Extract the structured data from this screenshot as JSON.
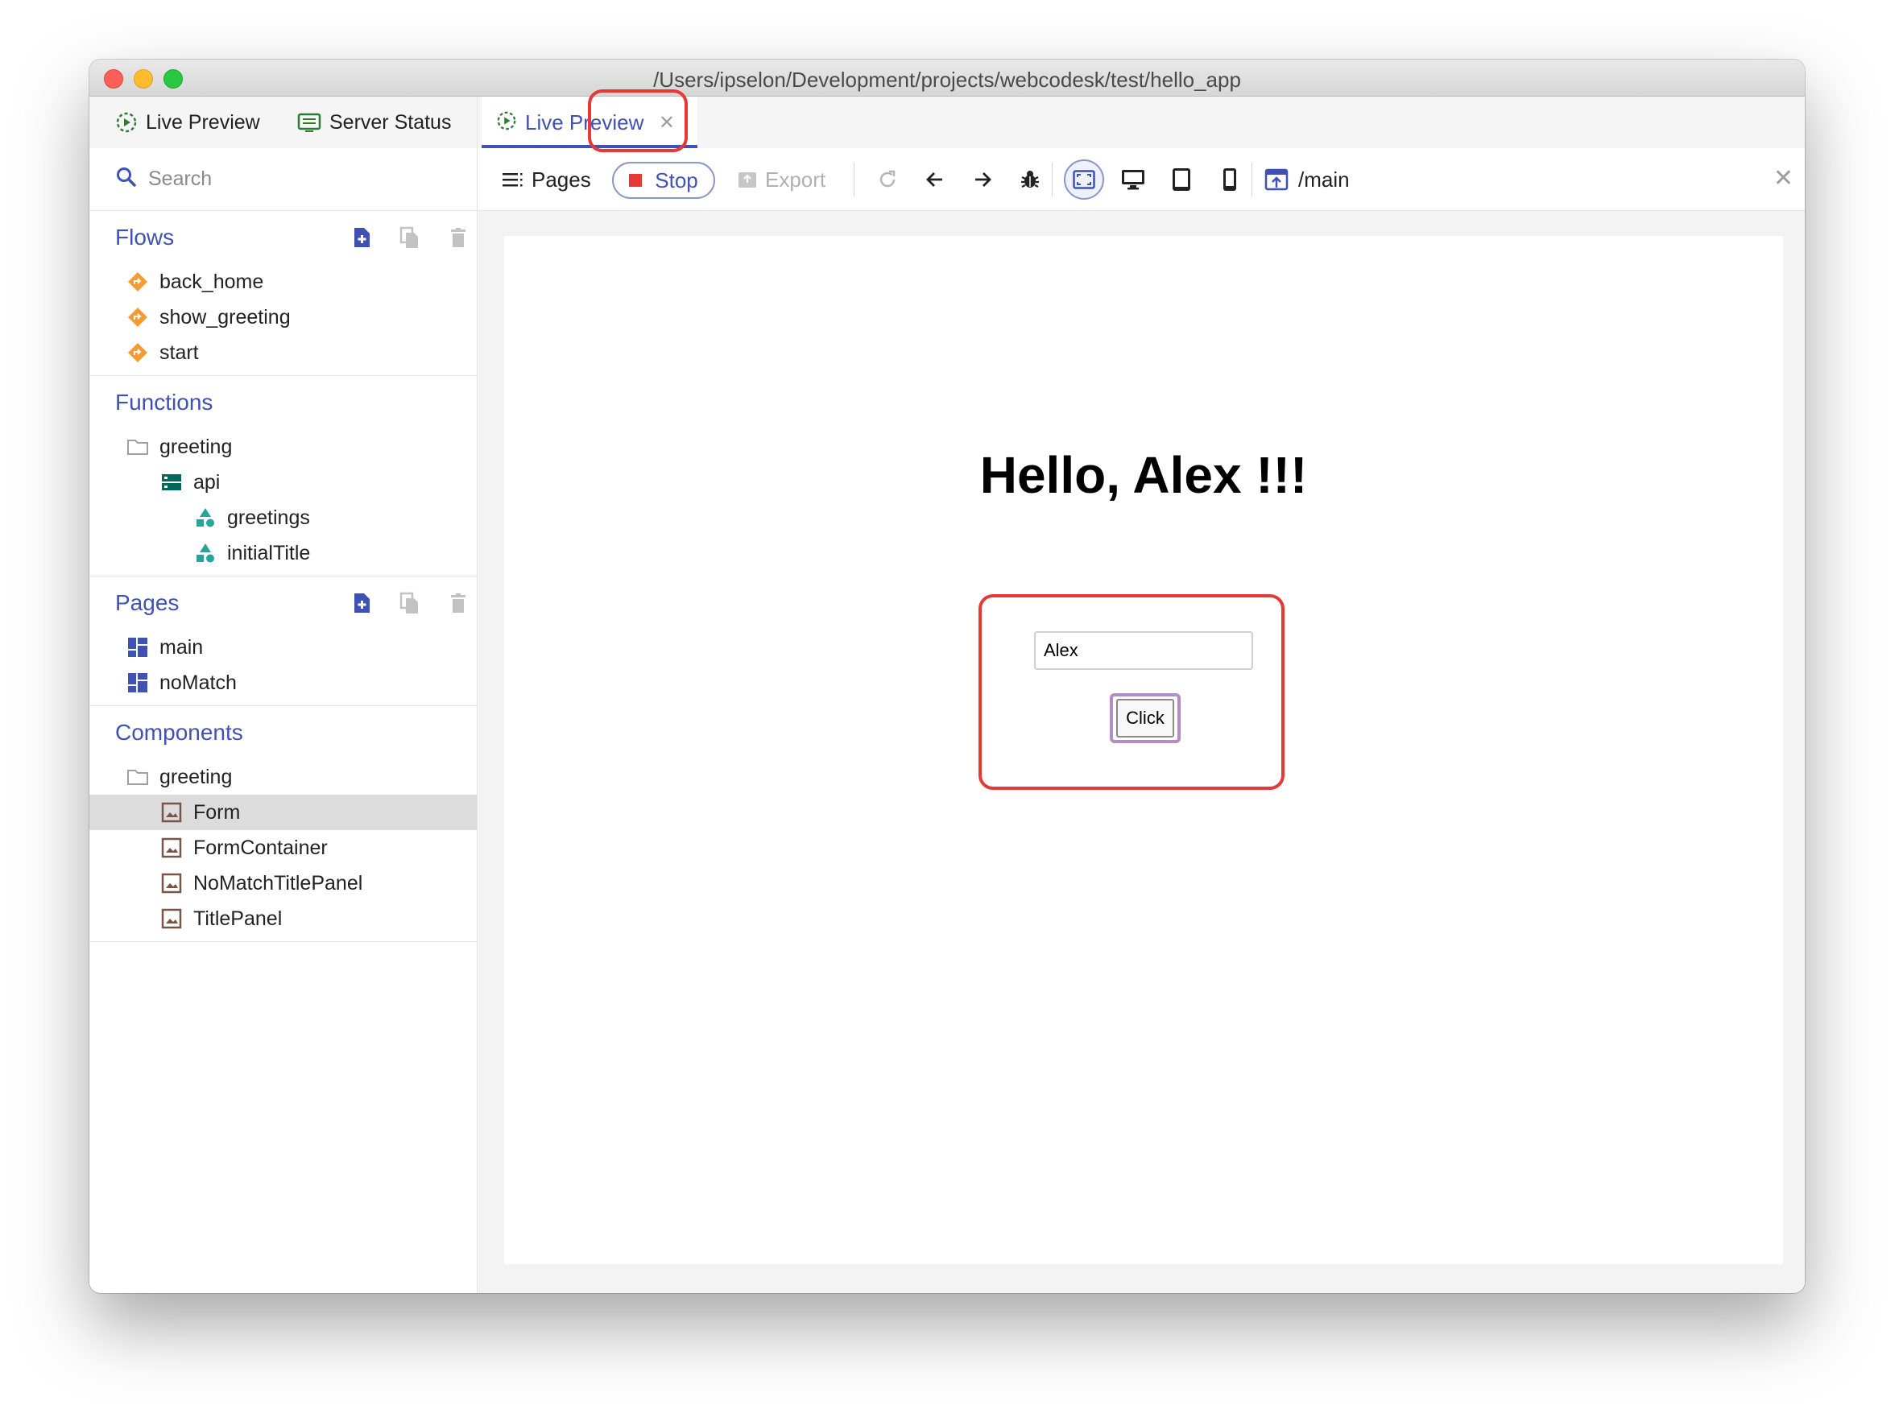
{
  "window": {
    "title": "/Users/ipselon/Development/projects/webcodesk/test/hello_app"
  },
  "sidebar": {
    "tabs": [
      {
        "label": "Live Preview",
        "icon": "play-circle-icon"
      },
      {
        "label": "Server Status",
        "icon": "server-status-icon"
      }
    ],
    "search": {
      "placeholder": "Search"
    },
    "flows": {
      "title": "Flows",
      "items": [
        {
          "label": "back_home",
          "icon": "flow-icon"
        },
        {
          "label": "show_greeting",
          "icon": "flow-icon"
        },
        {
          "label": "start",
          "icon": "flow-icon"
        }
      ]
    },
    "functions": {
      "title": "Functions",
      "folder": "greeting",
      "group": "api",
      "items": [
        {
          "label": "greetings",
          "icon": "function-icon"
        },
        {
          "label": "initialTitle",
          "icon": "function-icon"
        }
      ]
    },
    "pages": {
      "title": "Pages",
      "items": [
        {
          "label": "main",
          "icon": "page-icon"
        },
        {
          "label": "noMatch",
          "icon": "page-icon"
        }
      ]
    },
    "components": {
      "title": "Components",
      "folder": "greeting",
      "items": [
        {
          "label": "Form",
          "icon": "component-icon",
          "selected": true
        },
        {
          "label": "FormContainer",
          "icon": "component-icon"
        },
        {
          "label": "NoMatchTitlePanel",
          "icon": "component-icon"
        },
        {
          "label": "TitlePanel",
          "icon": "component-icon"
        }
      ]
    }
  },
  "main": {
    "tab": {
      "label": "Live Preview",
      "icon": "play-circle-icon"
    },
    "toolbar": {
      "pages_label": "Pages",
      "stop_label": "Stop",
      "export_label": "Export",
      "route": "/main"
    },
    "preview": {
      "heading": "Hello, Alex !!!",
      "input_value": "Alex",
      "button_label": "Click"
    }
  },
  "colors": {
    "accent": "#3f51b5",
    "flow": "#f39c33",
    "function": "#26a69a",
    "component": "#795548",
    "stop": "#e53935",
    "annotation": "#e53935"
  }
}
